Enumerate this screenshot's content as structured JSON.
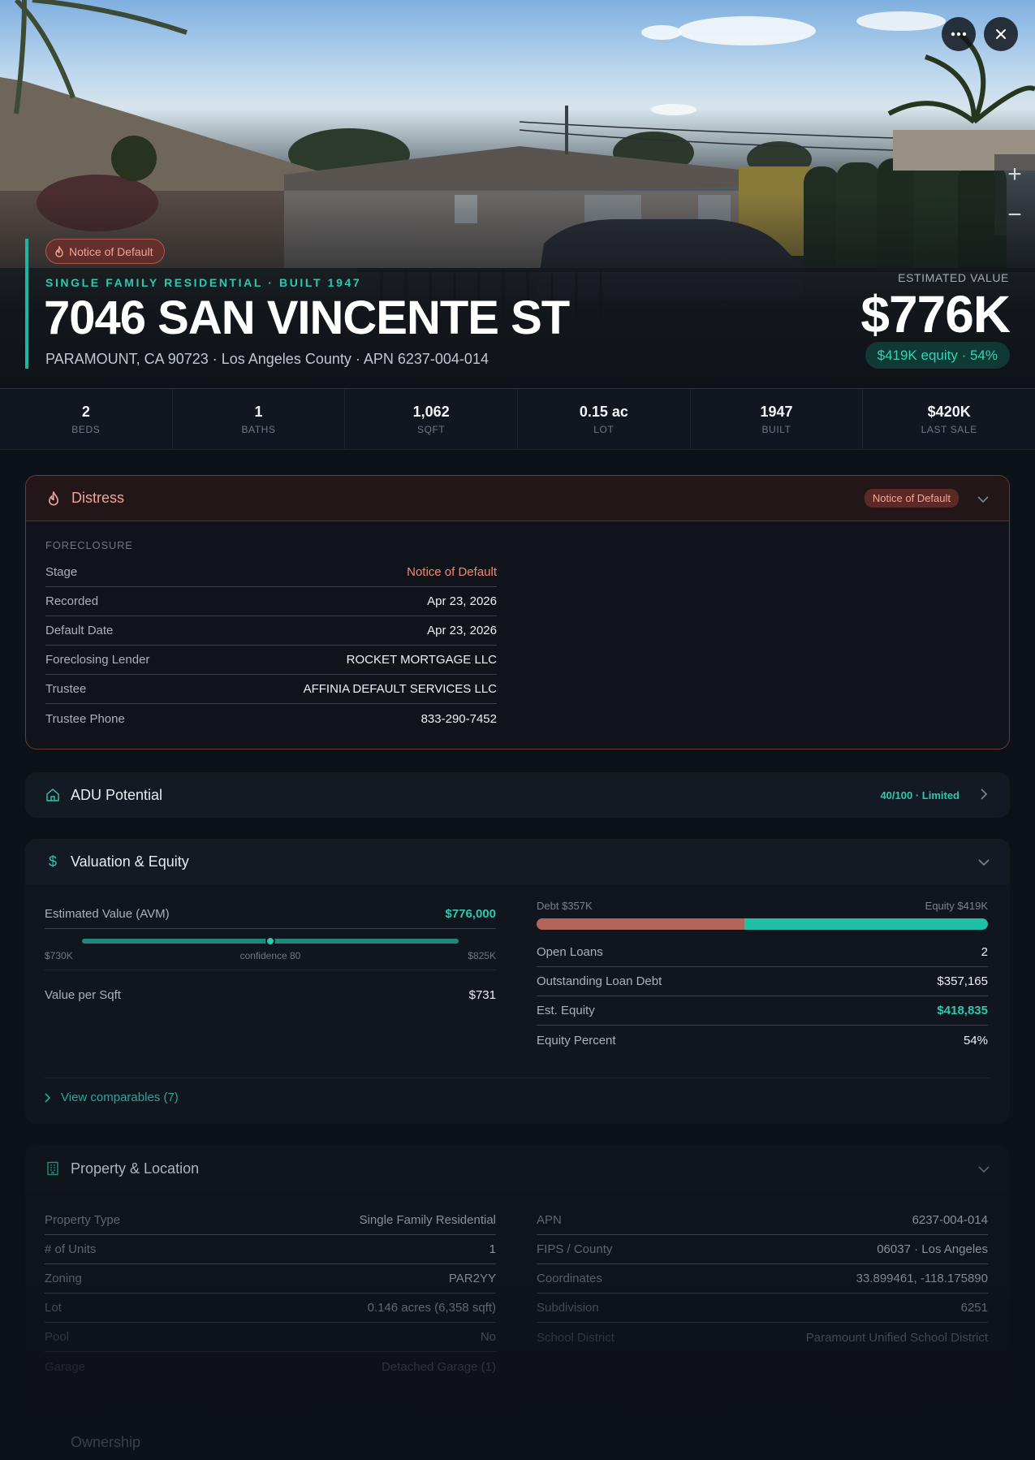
{
  "hero": {
    "badge": "Notice of Default",
    "eyebrow": "SINGLE FAMILY RESIDENTIAL · BUILT 1947",
    "title": "7046 SAN VINCENTE ST",
    "subtitle": "PARAMOUNT, CA 90723 · Los Angeles County · APN 6237-004-014",
    "est_label": "ESTIMATED VALUE",
    "est_value": "$776K",
    "equity_pill": "$419K equity · 54%",
    "more_icon": "more-horizontal-icon",
    "close_icon": "close-icon",
    "zoom_in": "+",
    "zoom_out": "−"
  },
  "stats": [
    {
      "value": "2",
      "label": "BEDS"
    },
    {
      "value": "1",
      "label": "BATHS"
    },
    {
      "value": "1,062",
      "label": "SQFT"
    },
    {
      "value": "0.15 ac",
      "label": "LOT"
    },
    {
      "value": "1947",
      "label": "BUILT"
    },
    {
      "value": "$420K",
      "label": "LAST SALE"
    }
  ],
  "distress": {
    "title": "Distress",
    "badge": "Notice of Default",
    "section": "FORECLOSURE",
    "rows": [
      {
        "k": "Stage",
        "v": "Notice of Default"
      },
      {
        "k": "Recorded",
        "v": "Apr 23, 2026"
      },
      {
        "k": "Default Date",
        "v": "Apr 23, 2026"
      },
      {
        "k": "Foreclosing Lender",
        "v": "ROCKET MORTGAGE LLC"
      },
      {
        "k": "Trustee",
        "v": "AFFINIA DEFAULT SERVICES LLC"
      },
      {
        "k": "Trustee Phone",
        "v": "833-290-7452"
      }
    ],
    "accent": "#f08a76"
  },
  "adu": {
    "title": "ADU Potential",
    "score": "40/100 · Limited"
  },
  "valuation": {
    "title": "Valuation & Equity",
    "avm_label": "Estimated Value (AVM)",
    "avm_value": "$776,000",
    "range_low": "$730K",
    "range_high": "$825K",
    "confidence": "confidence 80",
    "range_position": 0.5,
    "per_sqft_label": "Value per Sqft",
    "per_sqft_value": "$731",
    "debt_label": "Debt $357K",
    "equity_label": "Equity $419K",
    "debt_fraction": 0.46,
    "rows": [
      {
        "k": "Open Loans",
        "v": "2"
      },
      {
        "k": "Outstanding Loan Debt",
        "v": "$357,165"
      },
      {
        "k": "Est. Equity",
        "v": "$418,835"
      },
      {
        "k": "Equity Percent",
        "v": "54%"
      }
    ],
    "comps": "View comparables (7)"
  },
  "property": {
    "title": "Property & Location",
    "left": [
      {
        "k": "Property Type",
        "v": "Single Family Residential"
      },
      {
        "k": "# of Units",
        "v": "1"
      },
      {
        "k": "Zoning",
        "v": "PAR2YY"
      },
      {
        "k": "Lot",
        "v": "0.146 acres (6,358 sqft)"
      },
      {
        "k": "Pool",
        "v": "No"
      },
      {
        "k": "Garage",
        "v": "Detached Garage (1)"
      }
    ],
    "right": [
      {
        "k": "APN",
        "v": "6237-004-014"
      },
      {
        "k": "FIPS / County",
        "v": "06037 · Los Angeles"
      },
      {
        "k": "Coordinates",
        "v": "33.899461, -118.175890"
      },
      {
        "k": "Subdivision",
        "v": "6251"
      },
      {
        "k": "School District",
        "v": "Paramount Unified School District"
      }
    ]
  },
  "ownership": {
    "title": "Ownership"
  },
  "colors": {
    "accent": "#1fb5a0",
    "distress": "#f0a497",
    "debt": "#b2645a",
    "equity": "#1fbfa8"
  }
}
